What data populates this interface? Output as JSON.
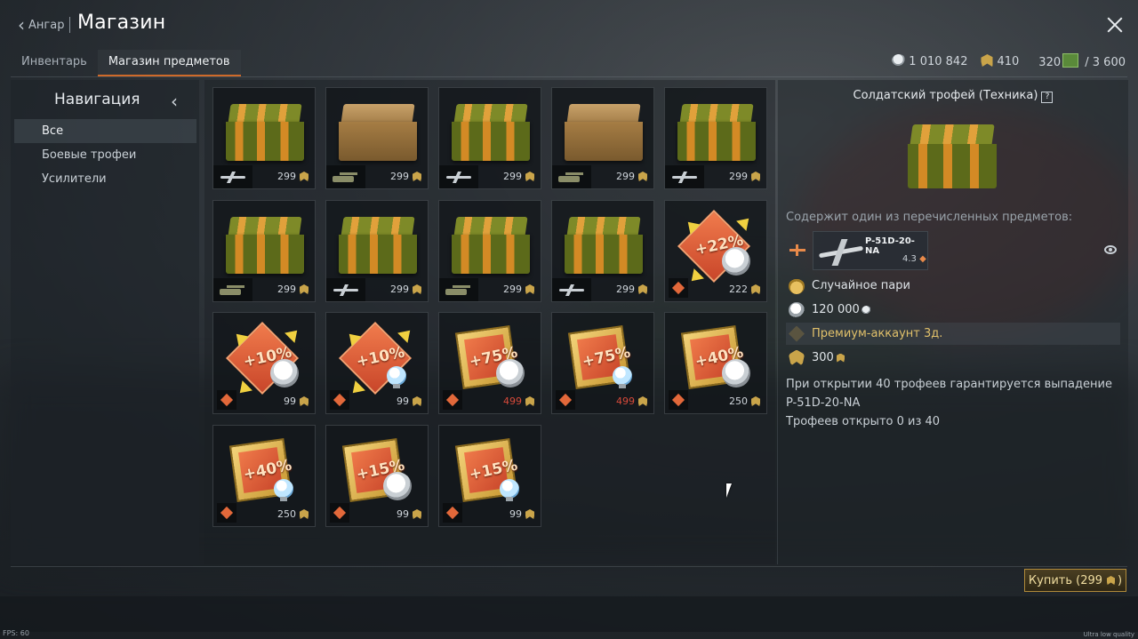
{
  "header": {
    "back_label": "Ангар",
    "title": "Магазин"
  },
  "tabs": [
    {
      "label": "Инвентарь",
      "active": false
    },
    {
      "label": "Магазин предметов",
      "active": true
    }
  ],
  "wallet": {
    "silver_lions": "1 010 842",
    "golden_eagles": "410",
    "premium_current": "320",
    "premium_total": "/ 3 600"
  },
  "nav": {
    "title": "Навигация",
    "items": [
      {
        "label": "Все",
        "selected": true
      },
      {
        "label": "Боевые трофеи",
        "selected": false
      },
      {
        "label": "Усилители",
        "selected": false
      }
    ]
  },
  "items": [
    {
      "kind": "crate",
      "style": "green",
      "vehicle": "plane",
      "price": "299"
    },
    {
      "kind": "crate",
      "style": "tan",
      "vehicle": "tank",
      "price": "299"
    },
    {
      "kind": "crate",
      "style": "green",
      "vehicle": "plane",
      "price": "299"
    },
    {
      "kind": "crate",
      "style": "tan",
      "vehicle": "tank",
      "price": "299"
    },
    {
      "kind": "crate",
      "style": "green",
      "vehicle": "plane",
      "price": "299"
    },
    {
      "kind": "crate",
      "style": "green",
      "vehicle": "tank",
      "price": "299"
    },
    {
      "kind": "crate",
      "style": "green",
      "vehicle": "plane",
      "price": "299"
    },
    {
      "kind": "crate",
      "style": "green",
      "vehicle": "tank",
      "price": "299"
    },
    {
      "kind": "crate",
      "style": "green",
      "vehicle": "plane",
      "price": "299"
    },
    {
      "kind": "booster",
      "card": "diamond",
      "pct": "+22%",
      "symbol": "lion",
      "price": "222",
      "price_red": false
    },
    {
      "kind": "booster",
      "card": "diamond",
      "pct": "+10%",
      "symbol": "lion",
      "price": "99",
      "price_red": false
    },
    {
      "kind": "booster",
      "card": "diamond",
      "pct": "+10%",
      "symbol": "bulb",
      "price": "99",
      "price_red": false
    },
    {
      "kind": "booster",
      "card": "gold",
      "pct": "+75%",
      "symbol": "lion",
      "price": "499",
      "price_red": true
    },
    {
      "kind": "booster",
      "card": "gold",
      "pct": "+75%",
      "symbol": "bulb",
      "price": "499",
      "price_red": true
    },
    {
      "kind": "booster",
      "card": "gold",
      "pct": "+40%",
      "symbol": "lion",
      "price": "250",
      "price_red": false
    },
    {
      "kind": "booster",
      "card": "gold",
      "pct": "+40%",
      "symbol": "bulb",
      "price": "250",
      "price_red": false
    },
    {
      "kind": "booster",
      "card": "gold",
      "pct": "+15%",
      "symbol": "lion",
      "price": "99",
      "price_red": false
    },
    {
      "kind": "booster",
      "card": "gold",
      "pct": "+15%",
      "symbol": "bulb",
      "price": "99",
      "price_red": false
    }
  ],
  "detail": {
    "title": "Солдатский трофей (Техника)",
    "help_glyph": "?",
    "contains_label": "Содержит один из перечисленных предметов:",
    "vehicle": {
      "name": "P-51D-20-NA",
      "br": "4.3"
    },
    "rewards": [
      {
        "icon": "wager-icon",
        "label": "Случайное пари",
        "highlight": false
      },
      {
        "icon": "silver-lion-icon",
        "label": "120 000",
        "highlight": false
      },
      {
        "icon": "premium-icon",
        "label": "Премиум-аккаунт 3д.",
        "highlight": true
      },
      {
        "icon": "golden-eagle-icon",
        "label": "300",
        "highlight": false
      }
    ],
    "guarantee_line1": "При открытии 40 трофеев гарантируется выпадение",
    "guarantee_line2": "P-51D-20-NA",
    "opened_line": "Трофеев открыто 0 из 40"
  },
  "buy_button": {
    "label": "Купить (299",
    "suffix": ")"
  },
  "footer": {
    "fps": "FPS: 60",
    "quality": "Ultra low quality"
  },
  "colors": {
    "accent": "#cf6a2a",
    "gold": "#c9a44a",
    "price_red": "#d84a3a",
    "highlight_text": "#e0c06a"
  }
}
